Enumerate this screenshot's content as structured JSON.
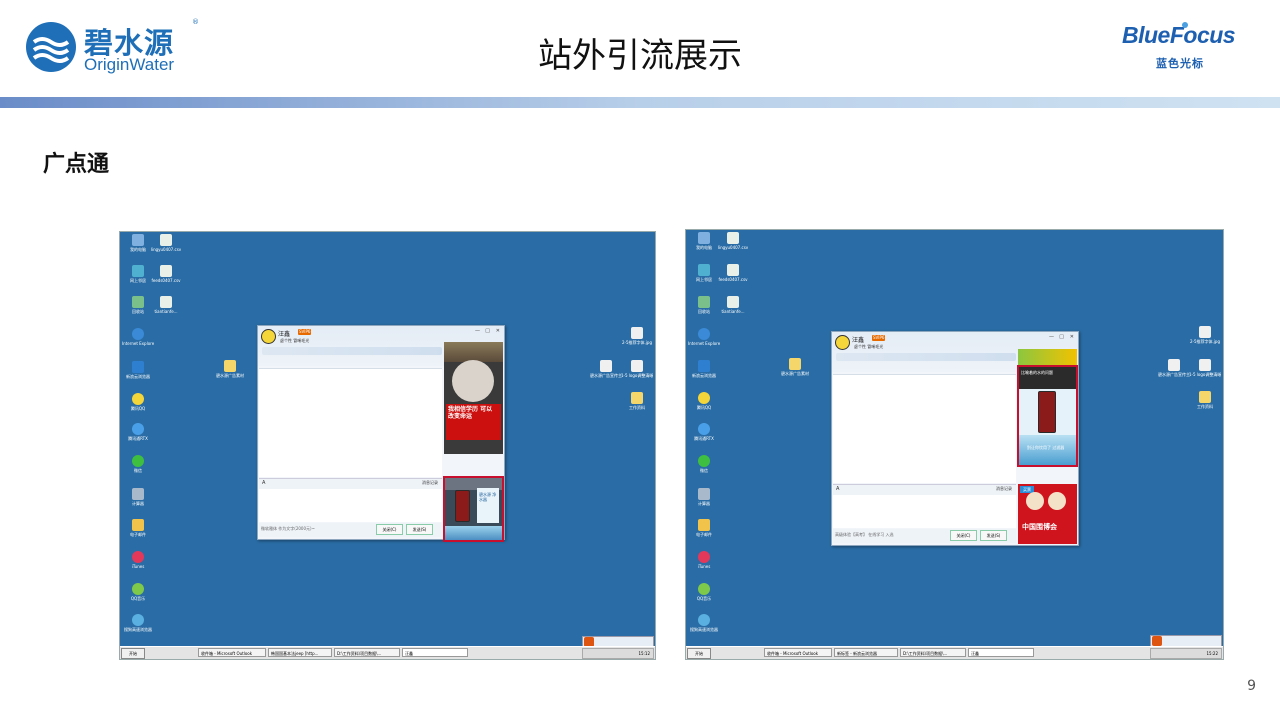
{
  "header": {
    "logo_left_cn": "碧水源",
    "logo_left_reg": "®",
    "logo_left_en": "OriginWater",
    "title": "站外引流展示",
    "logo_right_en": "BlueFocus",
    "logo_right_cn": "蓝色光标"
  },
  "section_title": "广点通",
  "page_number": "9",
  "colors": {
    "desktop": "#2a6da6",
    "accent_blue": "#1e6fb8",
    "highlight_red": "#c8102e"
  },
  "screenshot1": {
    "desktop_icons_left": [
      {
        "label": "我的电脑",
        "icon": "computer-icon"
      },
      {
        "label": "lingyu0407.csv",
        "icon": "file-icon"
      },
      {
        "label": "网上邻居",
        "icon": "network-icon"
      },
      {
        "label": "feeds0407.csv",
        "icon": "file-icon"
      },
      {
        "label": "回收站",
        "icon": "recycle-bin-icon"
      },
      {
        "label": "tiantianfe...",
        "icon": "file-icon"
      },
      {
        "label": "Internet Explorer",
        "icon": "ie-icon"
      },
      {
        "label": "新浪云浏览器",
        "icon": "browser-icon"
      },
      {
        "label": "腾讯QQ",
        "icon": "qq-icon"
      },
      {
        "label": "腾讯通RTX",
        "icon": "rtx-icon"
      },
      {
        "label": "微信",
        "icon": "wechat-icon"
      },
      {
        "label": "计算器",
        "icon": "calculator-icon"
      },
      {
        "label": "电子邮件",
        "icon": "mail-icon"
      },
      {
        "label": "iTunes",
        "icon": "itunes-icon"
      },
      {
        "label": "QQ音乐",
        "icon": "music-icon"
      },
      {
        "label": "搜狗高速浏览器",
        "icon": "sogou-icon"
      },
      {
        "label": "碧水源广告素材",
        "icon": "folder-icon"
      }
    ],
    "desktop_icons_right": [
      {
        "label": "2-5推荐字体.jpg",
        "icon": "image-icon"
      },
      {
        "label": "碧水源广告宣传主图",
        "icon": "image-icon"
      },
      {
        "label": "1-5 logo调整清晰.jpg",
        "icon": "image-icon"
      },
      {
        "label": "工作资料",
        "icon": "folder-icon"
      }
    ],
    "qq_window": {
      "contact_name": "汪鑫",
      "badge": "SVIP6",
      "signature": "虚个性 冒唏毛光",
      "input_hint": "微软雅体 作为文字(2000元)~",
      "chat_record": "消息记录",
      "close_btn": "关闭(C)",
      "send_btn": "发送(S)"
    },
    "ad_top": {
      "text": "我相信学历 可以 改变命运"
    },
    "ad_bottom": {
      "text": "碧水源 净水器"
    },
    "taskbar": {
      "start": "开始",
      "tasks": [
        "收件箱 - Microsoft Outlook",
        "韩国国基本法jeep [http...",
        "D:\\工作资料\\项目数据\\...",
        "汪鑫"
      ],
      "clock": "15:12"
    }
  },
  "screenshot2": {
    "desktop_icons_left": [
      {
        "label": "我的电脑",
        "icon": "computer-icon"
      },
      {
        "label": "lingyu0407.csv",
        "icon": "file-icon"
      },
      {
        "label": "网上邻居",
        "icon": "network-icon"
      },
      {
        "label": "feeds0407.csv",
        "icon": "file-icon"
      },
      {
        "label": "回收站",
        "icon": "recycle-bin-icon"
      },
      {
        "label": "tiantianfe...",
        "icon": "file-icon"
      },
      {
        "label": "Internet Explorer",
        "icon": "ie-icon"
      },
      {
        "label": "新浪云浏览器",
        "icon": "browser-icon"
      },
      {
        "label": "腾讯QQ",
        "icon": "qq-icon"
      },
      {
        "label": "腾讯通RTX",
        "icon": "rtx-icon"
      },
      {
        "label": "微信",
        "icon": "wechat-icon"
      },
      {
        "label": "计算器",
        "icon": "calculator-icon"
      },
      {
        "label": "电子邮件",
        "icon": "mail-icon"
      },
      {
        "label": "iTunes",
        "icon": "itunes-icon"
      },
      {
        "label": "QQ音乐",
        "icon": "music-icon"
      },
      {
        "label": "搜狗高速浏览器",
        "icon": "sogou-icon"
      },
      {
        "label": "碧水源广告素材",
        "icon": "folder-icon"
      }
    ],
    "desktop_icons_right": [
      {
        "label": "2-5推荐字体.jpg",
        "icon": "image-icon"
      },
      {
        "label": "碧水源广告宣传主图",
        "icon": "image-icon"
      },
      {
        "label": "1-5 logo调整清晰.jpg",
        "icon": "image-icon"
      },
      {
        "label": "工作资料",
        "icon": "folder-icon"
      }
    ],
    "qq_window": {
      "contact_name": "汪鑫",
      "badge": "SVIP6",
      "signature": "虚个性 冒唏毛光",
      "input_hint": "高级体验【高考】 在线学习 入选",
      "chat_record": "消息记录",
      "close_btn": "关闭(C)",
      "send_btn": "发送(S)"
    },
    "ad_top": {
      "text_top": "比喻着的水的问题",
      "text_bottom": "别让你饮用了 过滤器"
    },
    "ad_bottom": {
      "tag": "买票",
      "text": "中国围博会"
    },
    "taskbar": {
      "start": "开始",
      "tasks": [
        "收件箱 - Microsoft Outlook",
        "新标签 - 新浪云浏览器",
        "D:\\工作资料\\项目数据\\...",
        "汪鑫"
      ],
      "clock": "15:22"
    }
  }
}
